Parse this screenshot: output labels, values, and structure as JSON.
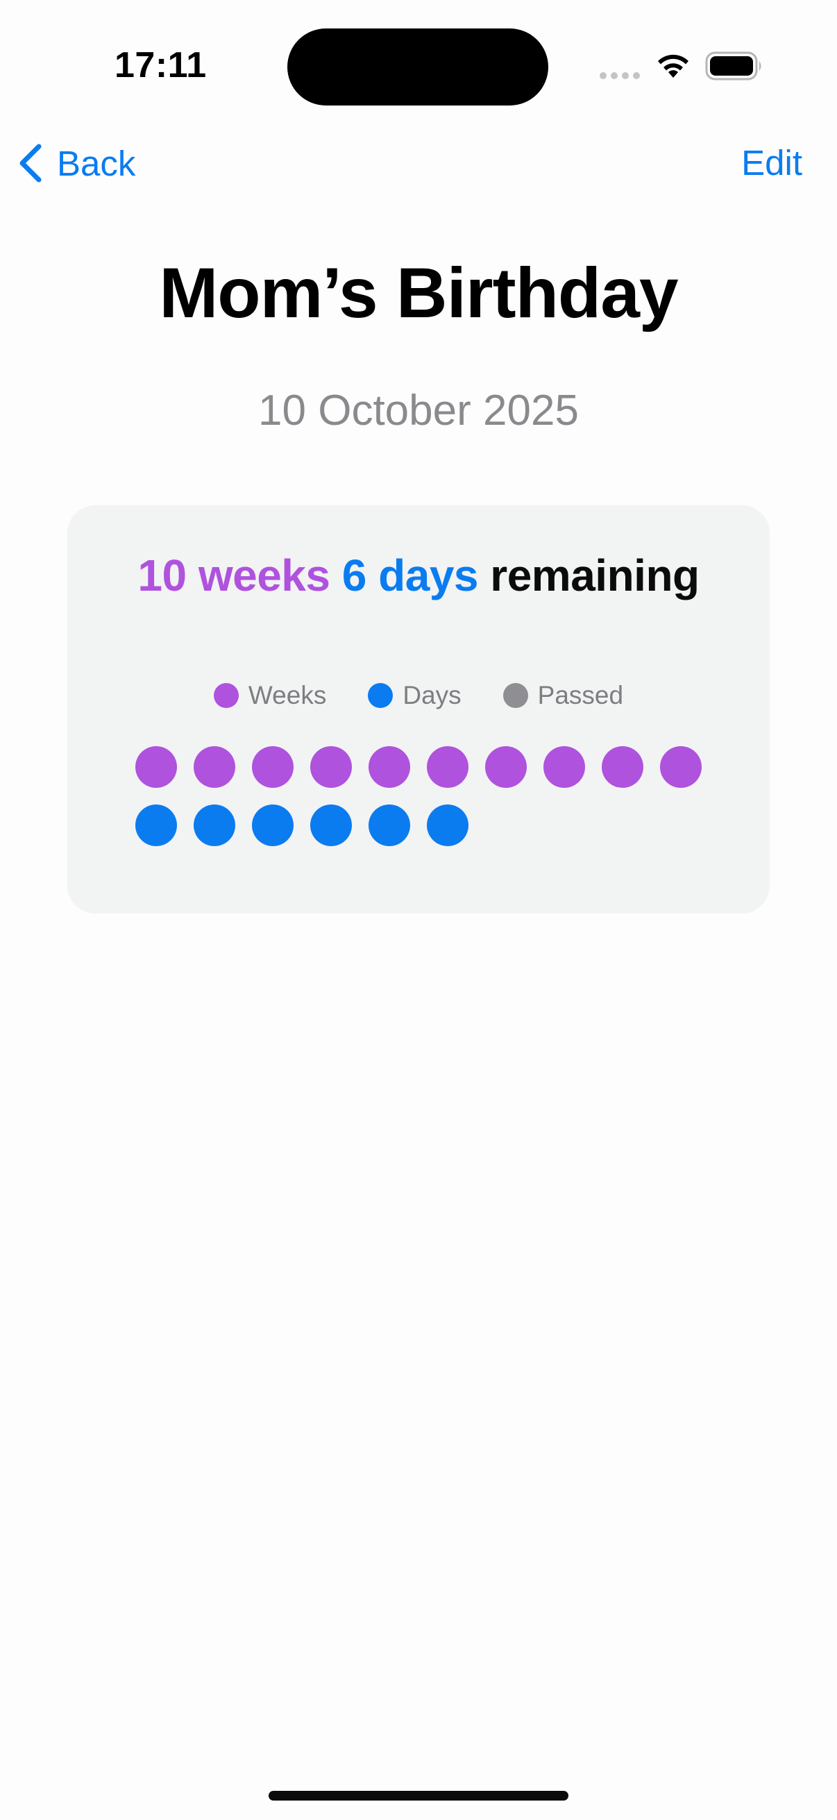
{
  "status_bar": {
    "time": "17:11"
  },
  "nav": {
    "back_label": "Back",
    "edit_label": "Edit",
    "back_icon": "chevron-left-icon"
  },
  "event": {
    "title": "Mom’s Birthday",
    "date": "10 October 2025"
  },
  "countdown": {
    "weeks_text": "10 weeks",
    "days_text": "6 days",
    "remaining_text": "remaining",
    "weeks": 10,
    "days": 6,
    "passed": 0
  },
  "legend": {
    "weeks_label": "Weeks",
    "days_label": "Days",
    "passed_label": "Passed"
  },
  "colors": {
    "weeks": "#af52de",
    "days": "#0a7cf0",
    "passed": "#8e8e93",
    "accent": "#0a7cf0"
  }
}
